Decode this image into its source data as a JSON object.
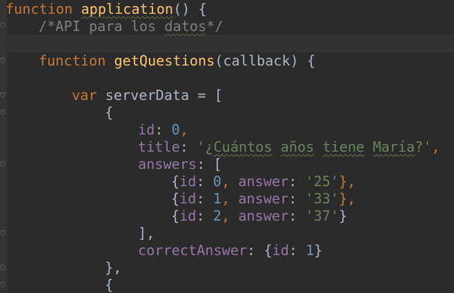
{
  "editor": {
    "colors": {
      "background": "#2b2b2b",
      "keyword": "#cc7832",
      "function_name": "#ffc66d",
      "comment": "#808080",
      "property": "#9876aa",
      "number": "#6897bb",
      "string": "#6a8759",
      "plain": "#a9b7c6"
    },
    "lines": {
      "l1": {
        "kw": "function",
        "name": "application",
        "rest": "() {"
      },
      "l2": {
        "comment_a": "/*API para los ",
        "comment_b": "datos",
        "comment_c": "*/"
      },
      "l4": {
        "kw": "function",
        "name": "getQuestions",
        "rest": "(callback) {"
      },
      "l6": {
        "kw": "var",
        "rest": " serverData = ["
      },
      "l7": {
        "text": "{"
      },
      "l8": {
        "prop": "id",
        "sep": ": ",
        "num": "0",
        "end": ","
      },
      "l9": {
        "prop": "title",
        "sep": ": ",
        "str_a": "'¿",
        "str_b": "Cuántos",
        "str_c": " ",
        "str_d": "años",
        "str_e": " ",
        "str_f": "tiene",
        "str_g": " ",
        "str_h": "María",
        "str_i": "?'",
        "end": ","
      },
      "l10": {
        "prop": "answers",
        "sep": ": ["
      },
      "l11": {
        "open": "{",
        "p1": "id",
        "s1": ": ",
        "n1": "0",
        "c1": ", ",
        "p2": "answer",
        "s2": ": ",
        "v": "'25'",
        "close": "},"
      },
      "l12": {
        "open": "{",
        "p1": "id",
        "s1": ": ",
        "n1": "1",
        "c1": ", ",
        "p2": "answer",
        "s2": ": ",
        "v": "'33'",
        "close": "},"
      },
      "l13": {
        "open": "{",
        "p1": "id",
        "s1": ": ",
        "n1": "2",
        "c1": ", ",
        "p2": "answer",
        "s2": ": ",
        "v": "'37'",
        "close": "}"
      },
      "l14": {
        "text": "],"
      },
      "l15": {
        "prop": "correctAnswer",
        "sep": ": {",
        "p": "id",
        "s": ": ",
        "num": "1",
        "close": "}"
      },
      "l16": {
        "text": "},"
      },
      "l17": {
        "text": "{"
      }
    }
  }
}
